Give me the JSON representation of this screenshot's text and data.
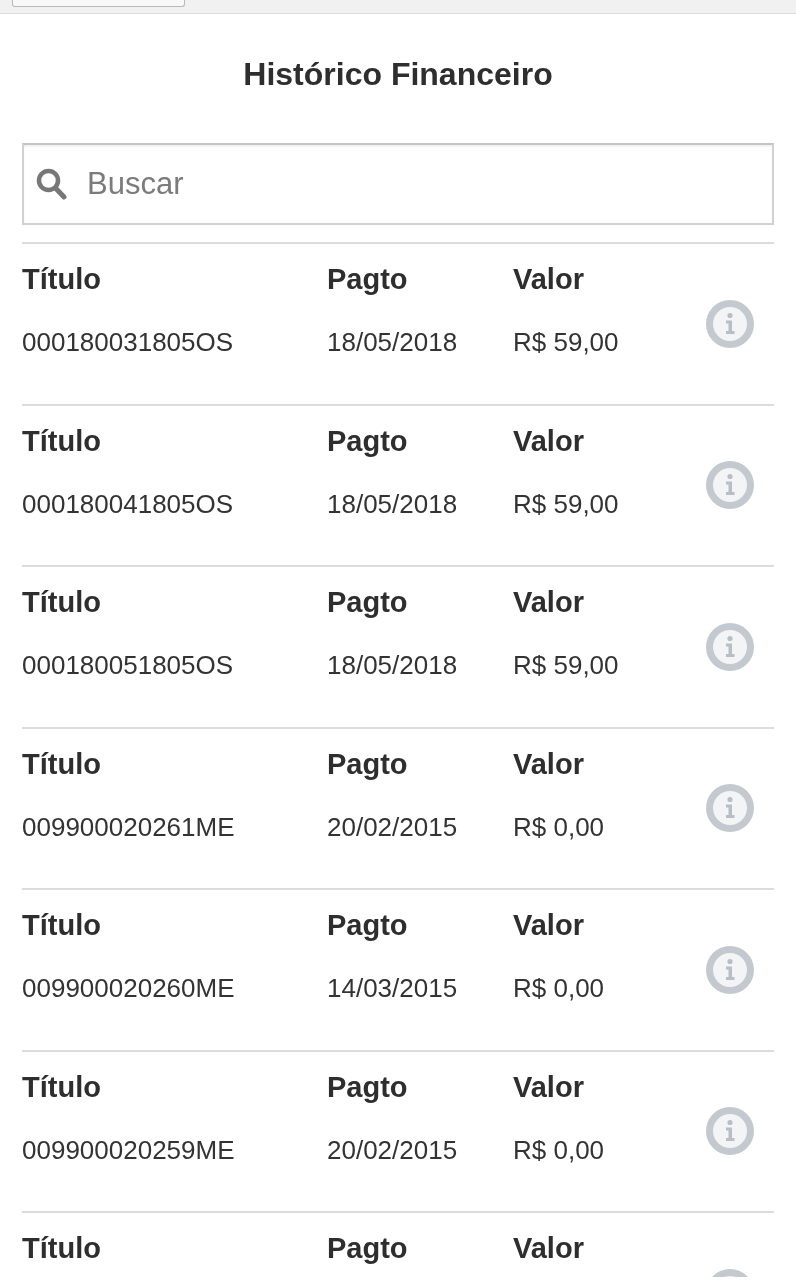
{
  "title": "Histórico Financeiro",
  "search": {
    "placeholder": "Buscar"
  },
  "records": [
    {
      "fields": [
        {
          "label": "Título",
          "value": "000180031805OS"
        },
        {
          "label": "Pagto",
          "value": "18/05/2018"
        },
        {
          "label": "Valor",
          "value": "R$ 59,00"
        }
      ]
    },
    {
      "fields": [
        {
          "label": "Título",
          "value": "000180041805OS"
        },
        {
          "label": "Pagto",
          "value": "18/05/2018"
        },
        {
          "label": "Valor",
          "value": "R$ 59,00"
        }
      ]
    },
    {
      "fields": [
        {
          "label": "Título",
          "value": "000180051805OS"
        },
        {
          "label": "Pagto",
          "value": "18/05/2018"
        },
        {
          "label": "Valor",
          "value": "R$ 59,00"
        }
      ]
    },
    {
      "fields": [
        {
          "label": "Título",
          "value": "009900020261ME"
        },
        {
          "label": "Pagto",
          "value": "20/02/2015"
        },
        {
          "label": "Valor",
          "value": "R$ 0,00"
        }
      ]
    },
    {
      "fields": [
        {
          "label": "Título",
          "value": "009900020260ME"
        },
        {
          "label": "Pagto",
          "value": "14/03/2015"
        },
        {
          "label": "Valor",
          "value": "R$ 0,00"
        }
      ]
    },
    {
      "fields": [
        {
          "label": "Título",
          "value": "009900020259ME"
        },
        {
          "label": "Pagto",
          "value": "20/02/2015"
        },
        {
          "label": "Valor",
          "value": "R$ 0,00"
        }
      ]
    },
    {
      "fields": [
        {
          "label": "Título"
        },
        {
          "label": "Pagto"
        },
        {
          "label": "Valor"
        }
      ]
    }
  ]
}
